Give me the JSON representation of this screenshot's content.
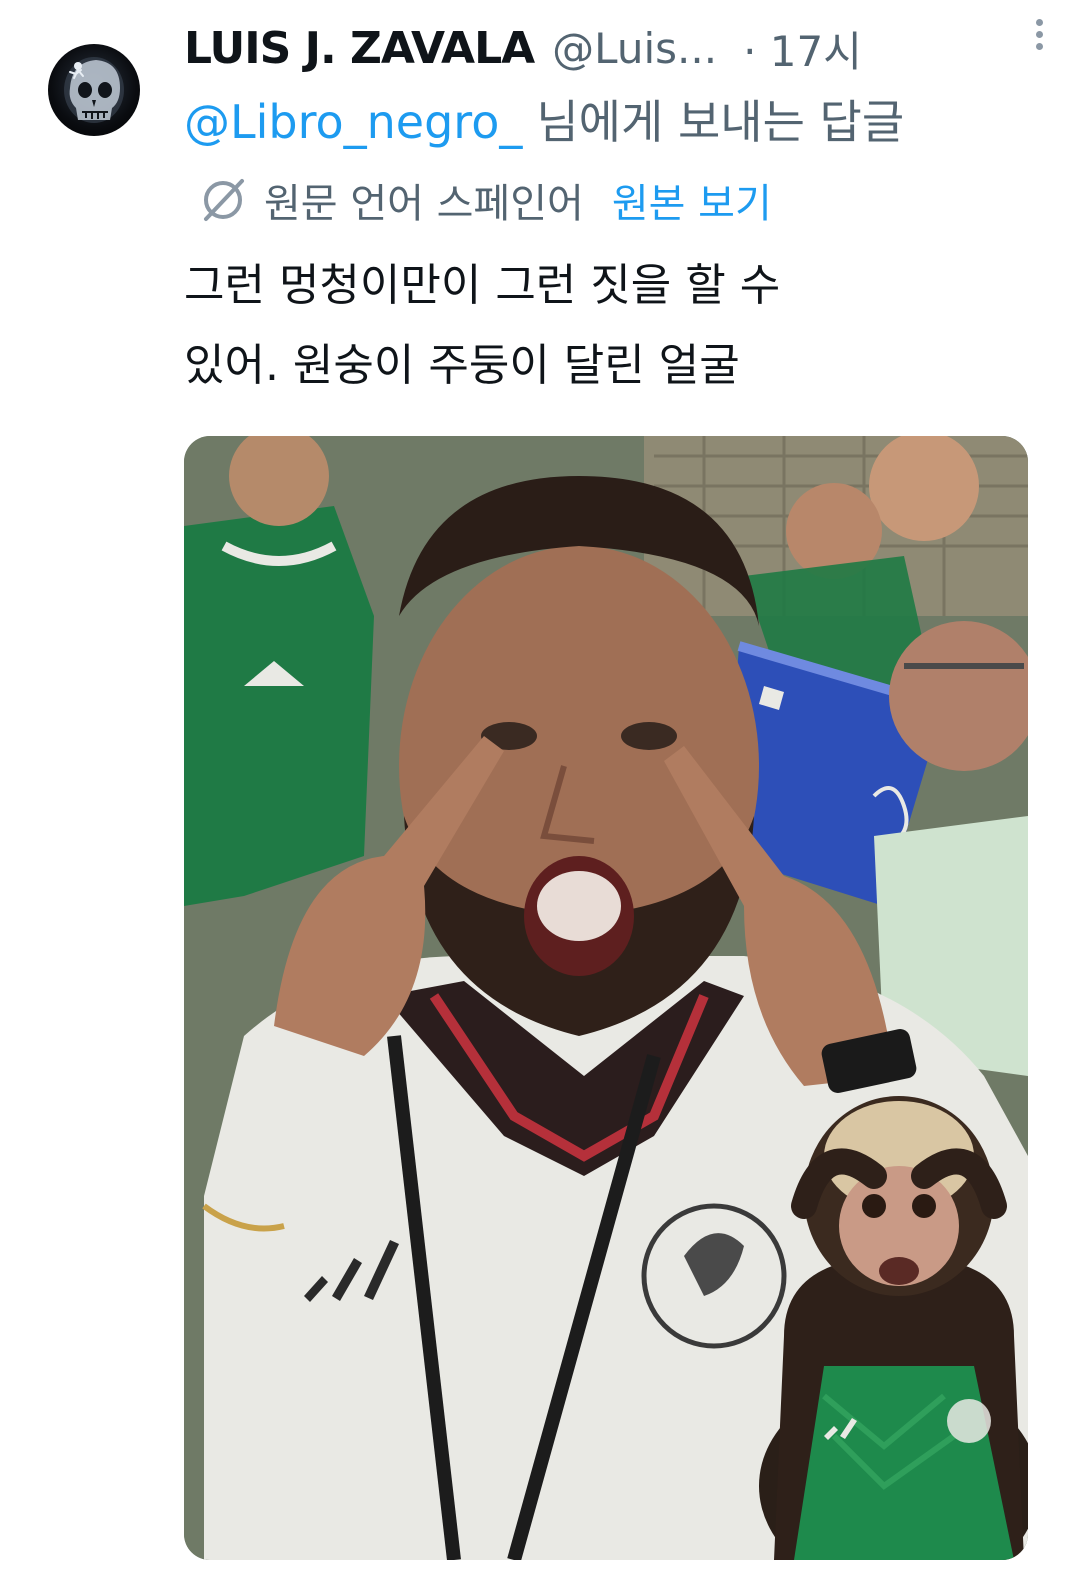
{
  "tweet": {
    "author": {
      "display_name": "LUIS J. ZAVALA",
      "handle": "@Luis...",
      "avatar_icon": "skull-xray-avatar"
    },
    "time": "· 17시",
    "reply_to": {
      "handle": "@Libro_negro_",
      "suffix": "님에게 보내는 답글"
    },
    "translation": {
      "icon": "translate-icon",
      "label": "원문 언어 스페인어",
      "show_original": "원본 보기"
    },
    "text_lines": [
      "그런 멍청이만이 그런 짓을 할 수",
      "있어. 원숭이 주둥이 달린 얼굴"
    ],
    "media": {
      "type": "photo",
      "colors": {
        "jersey_white": "#e9e9e4",
        "jersey_green": "#1f7a45",
        "cup_blue": "#2d4fb8"
      }
    }
  },
  "colors": {
    "text_primary": "#0f1419",
    "text_secondary": "#536471",
    "accent": "#1d9bf0"
  }
}
